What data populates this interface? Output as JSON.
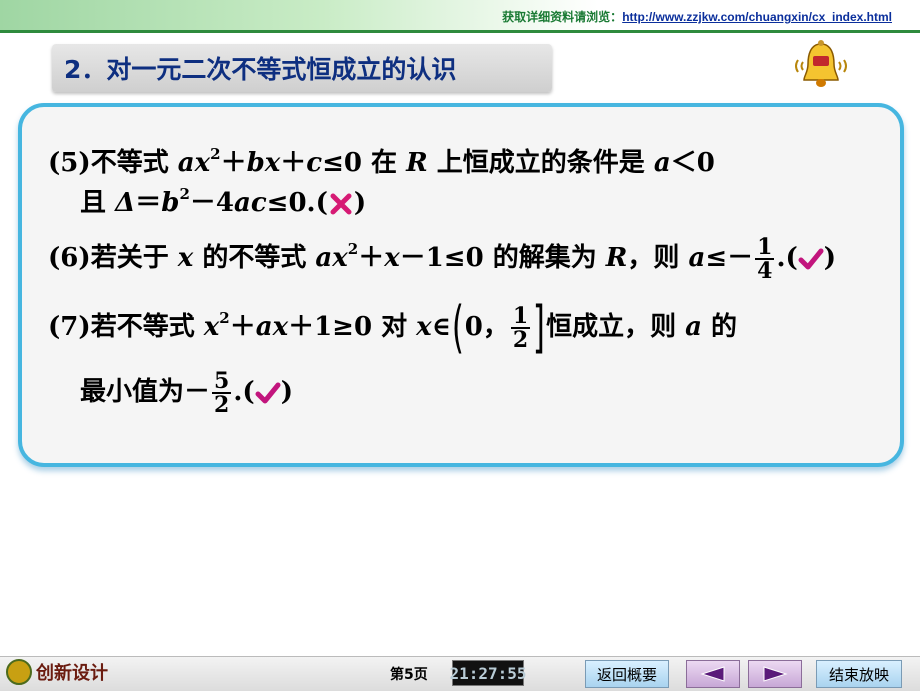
{
  "header": {
    "link_label": "获取详细资料请浏览：",
    "link_url": "http://www.zzjkw.com/chuangxin/cx_index.html"
  },
  "section": {
    "title": "2．对一元二次不等式恒成立的认识"
  },
  "items": {
    "i5": {
      "num": "(5)",
      "pre": "不等式 ",
      "a": "ax",
      "e2": "2",
      "p1": "＋",
      "b": "bx",
      "p2": "＋",
      "c": "c",
      "le0": "≤0 在 ",
      "R": "R",
      "mid": " 上恒成立的条件是 ",
      "a2": "a",
      "lt0": "＜0",
      "and": "且 ",
      "delta": "Δ",
      "eq": "＝",
      "bb": "b",
      "e2b": "2",
      "minus": "－4",
      "ac": "ac",
      "end": "≤0.(",
      "close": ")",
      "mark": "wrong"
    },
    "i6": {
      "num": "(6)",
      "pre": "若关于 ",
      "x": "x",
      "t1": " 的不等式 ",
      "ax": "ax",
      "e2": "2",
      "rest": "＋",
      "x2": "x",
      "rest2": "－1≤0 的解集为 ",
      "R": "R",
      "then": "，则 ",
      "a": "a",
      "leneg": "≤－",
      "num1": "1",
      "den": "4",
      "dot": ".(",
      "close": ")",
      "mark": "correct"
    },
    "i7": {
      "num": "(7)",
      "pre": "若不等式 ",
      "x": "x",
      "e2": "2",
      "p": "＋",
      "ax": "ax",
      "p2": "＋1≥0 对 ",
      "x2": "x",
      "in": "∈",
      "lparen": "(",
      "zero": "0，",
      "num1": "1",
      "den": "2",
      "rbracket": "]",
      "post": "恒成立，则 ",
      "a": "a",
      "de": " 的",
      "line2": "最小值为－",
      "num2": "5",
      "den2": "2",
      "dot": ".(",
      "close": ")",
      "mark": "correct"
    }
  },
  "footer": {
    "logo_text": "创新设计",
    "page": "第5页",
    "clock": "21:27:55",
    "back_overview": "返回概要",
    "end_show": "结束放映"
  },
  "colors": {
    "wrong": "#d61a74",
    "correct": "#c2157d",
    "heading": "#0e2f80",
    "card_border": "#46b6e0"
  }
}
